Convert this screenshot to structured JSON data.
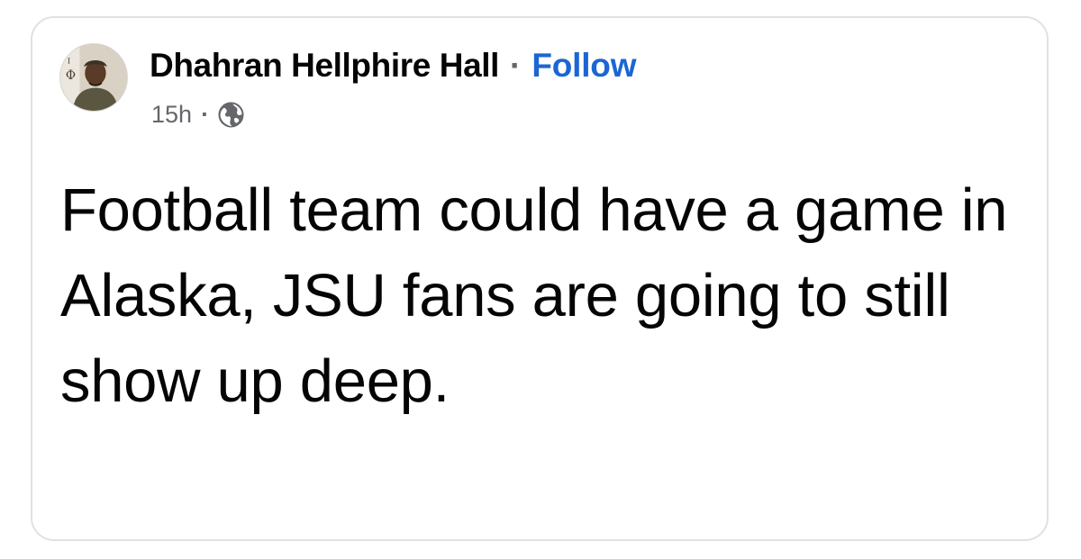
{
  "post": {
    "author_name": "Dhahran Hellphire Hall",
    "separator": "·",
    "follow_label": "Follow",
    "timestamp": "15h",
    "meta_separator": "·",
    "audience_icon": "globe-icon",
    "text": "Football team could have a game in Alaska, JSU fans are going to still show up deep."
  },
  "colors": {
    "follow": "#1b66d2",
    "meta": "#65676b",
    "text": "#050505",
    "card_border": "#dfe1e4"
  }
}
